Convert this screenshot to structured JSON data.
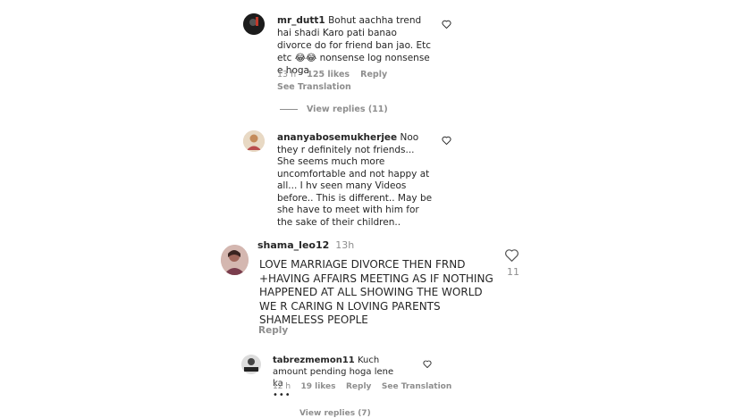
{
  "comments": [
    {
      "username": "mr_dutt1",
      "text": "Bohut aachha trend hai shadi Karo pati banao divorce do for friend ban jao. Etc etc 😂😂 nonsense log nonsense e hoga",
      "time": "13 h",
      "likes": "125 likes",
      "reply_label": "Reply",
      "translation_label": "See Translation",
      "view_replies_label": "View replies (11)"
    },
    {
      "username": "ananyabosemukherjee",
      "text": "Noo they r definitely not friends... She seems much more uncomfortable and not happy at all... I hv seen many Videos before.. This is different.. May be she have to meet with him for the sake of their children.."
    },
    {
      "username": "shama_leo12",
      "time": "13h",
      "text": "LOVE MARRIAGE DIVORCE THEN FRND +HAVING AFFAIRS  MEETING AS IF NOTHING HAPPENED AT ALL SHOWING THE WORLD WE R CARING N LOVING PARENTS SHAMELESS PEOPLE",
      "reply_label": "Reply",
      "like_count": "11"
    },
    {
      "username": "tabrezmemon11",
      "text": "Kuch amount pending hoga lene ka",
      "time": "12 h",
      "likes": "19 likes",
      "reply_label": "Reply",
      "translation_label": "See Translation",
      "more_label": "•••",
      "view_replies_label": "View replies (7)"
    }
  ],
  "icons": {
    "like": "heart-outline-icon",
    "avatar": "user-avatar"
  },
  "colors": {
    "text": "#262626",
    "secondary": "#8e8e8e",
    "background": "#ffffff"
  }
}
